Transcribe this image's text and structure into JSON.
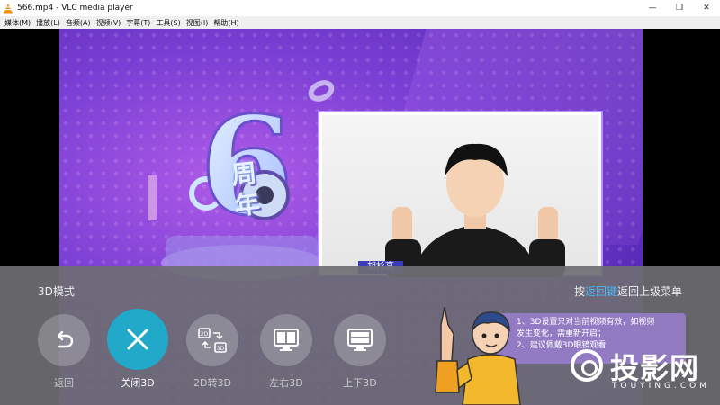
{
  "window": {
    "title": "566.mp4 - VLC media player",
    "minimize_glyph": "—",
    "maximize_glyph": "❐",
    "close_glyph": "✕"
  },
  "menu": [
    "媒体(M)",
    "播放(L)",
    "音频(A)",
    "视频(V)",
    "字幕(T)",
    "工具(S)",
    "视图(I)",
    "帮助(H)"
  ],
  "video": {
    "anniversary_number": "6",
    "anniversary_text": [
      "周",
      "年"
    ],
    "presenter_name": "胡杉高"
  },
  "osd": {
    "title": "3D模式",
    "hint_prefix": "按",
    "hint_key": "返回键",
    "hint_suffix": "返回上级菜单",
    "accent_color": "#22a8c8",
    "highlight_color": "#49b8f5",
    "buttons": [
      {
        "label": "返回",
        "icon": "undo-arrow-icon"
      },
      {
        "label": "关闭3D",
        "icon": "close-x-icon",
        "active": true
      },
      {
        "label": "2D转3D",
        "icon": "2d-to-3d-icon"
      },
      {
        "label": "左右3D",
        "icon": "side-by-side-icon"
      },
      {
        "label": "上下3D",
        "icon": "top-bottom-icon"
      }
    ],
    "icon_text": {
      "from": "2D",
      "to": "3D"
    },
    "note": [
      "1、3D设置只对当前视频有效，如视频",
      "发生变化，需重新开启；",
      "2、建议佩戴3D眼镜观看"
    ]
  },
  "watermark": {
    "text": "投影网",
    "sub": "TOUYING.COM"
  }
}
